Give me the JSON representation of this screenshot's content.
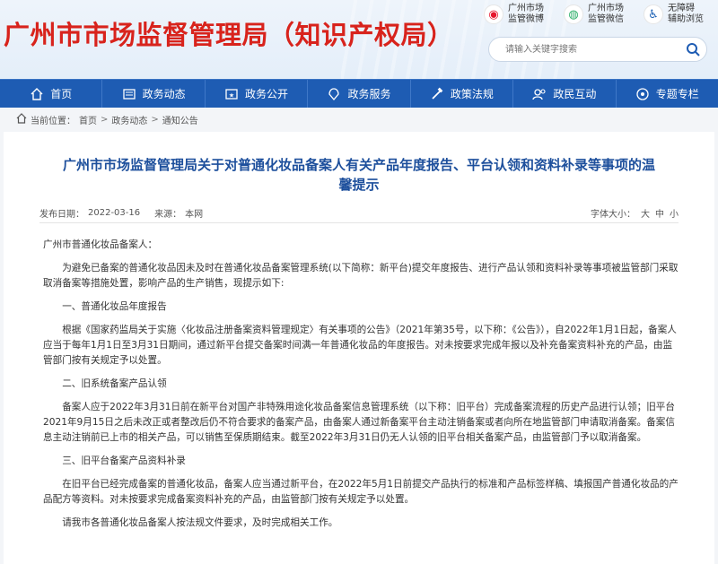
{
  "header": {
    "site_title": "广州市市场监督管理局（知识产权局）",
    "quick_links": [
      {
        "line1": "广州市场",
        "line2": "监管微博",
        "icon": "weibo-icon"
      },
      {
        "line1": "广州市场",
        "line2": "监管微信",
        "icon": "wechat-icon"
      },
      {
        "line1": "无障碍",
        "line2": "辅助浏览",
        "icon": "accessibility-icon"
      }
    ],
    "search_placeholder": "请输入关键字搜索"
  },
  "nav": [
    {
      "label": "首页",
      "icon": "home-icon"
    },
    {
      "label": "政务动态",
      "icon": "news-icon"
    },
    {
      "label": "政务公开",
      "icon": "disclosure-icon"
    },
    {
      "label": "政务服务",
      "icon": "service-icon"
    },
    {
      "label": "政策法规",
      "icon": "policy-icon"
    },
    {
      "label": "政民互动",
      "icon": "interaction-icon"
    },
    {
      "label": "专题专栏",
      "icon": "topic-icon"
    }
  ],
  "breadcrumb": {
    "prefix": "当前位置：",
    "items": [
      "首页",
      "政务动态",
      "通知公告"
    ],
    "sep": ">"
  },
  "article": {
    "title": "广州市市场监督管理局关于对普通化妆品备案人有关产品年度报告、平台认领和资料补录等事项的温馨提示",
    "publish_label": "发布日期：",
    "publish_date": "2022-03-16",
    "source_label": "来源：",
    "source": "本网",
    "font_size_label": "字体大小：",
    "font_sizes": [
      "大",
      "中",
      "小"
    ],
    "paragraphs": [
      {
        "text": "广州市普通化妆品备案人：",
        "indent": false
      },
      {
        "text": "为避免已备案的普通化妆品因未及时在普通化妆品备案管理系统(以下简称：新平台)提交年度报告、进行产品认领和资料补录等事项被监管部门采取取消备案等措施处置，影响产品的生产销售，现提示如下:",
        "indent": true
      },
      {
        "text": "一、普通化妆品年度报告",
        "indent": true
      },
      {
        "text": "根据《国家药监局关于实施〈化妆品注册备案资料管理规定〉有关事项的公告》（2021年第35号，以下称：《公告》），自2022年1月1日起，备案人应当于每年1月1日至3月31日期间，通过新平台提交备案时间满一年普通化妆品的年度报告。对未按要求完成年报以及补充备案资料补充的产品，由监管部门按有关规定予以处置。",
        "indent": true
      },
      {
        "text": "二、旧系统备案产品认领",
        "indent": true
      },
      {
        "text": "备案人应于2022年3月31日前在新平台对国产非特殊用途化妆品备案信息管理系统（以下称：旧平台）完成备案流程的历史产品进行认领；旧平台2021年9月15日之后未改正或者整改后仍不符合要求的备案产品，由备案人通过新备案平台主动注销备案或者向所在地监管部门申请取消备案。备案信息主动注销前已上市的相关产品，可以销售至保质期结束。截至2022年3月31日仍无人认领的旧平台相关备案产品，由监管部门予以取消备案。",
        "indent": true
      },
      {
        "text": "三、旧平台备案产品资料补录",
        "indent": true
      },
      {
        "text": "在旧平台已经完成备案的普通化妆品，备案人应当通过新平台，在2022年5月1日前提交产品执行的标准和产品标签样稿、填报国产普通化妆品的产品配方等资料。对未按要求完成备案资料补充的产品，由监管部门按有关规定予以处置。",
        "indent": true
      },
      {
        "text": "请我市各普通化妆品备案人按法规文件要求，及时完成相关工作。",
        "indent": true
      }
    ]
  },
  "colors": {
    "title_red": "#d8231c",
    "nav_blue": "#1e5cb3",
    "article_title_blue": "#1d4f9c"
  }
}
